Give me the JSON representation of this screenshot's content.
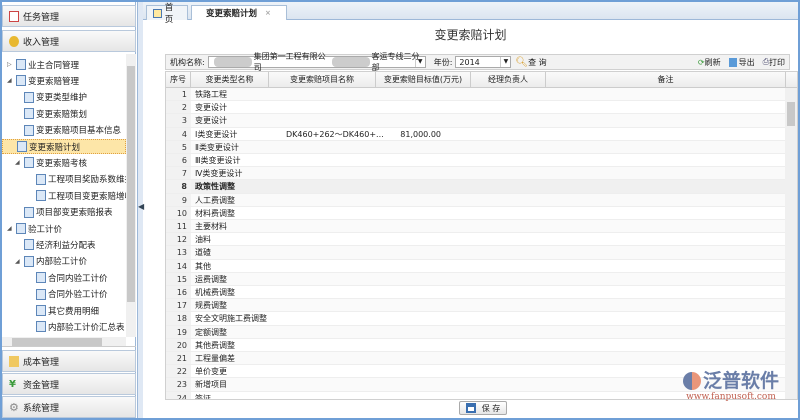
{
  "sidebar": {
    "sections_top": [
      "任务管理",
      "收入管理"
    ],
    "sections_bottom": [
      "成本管理",
      "资金管理",
      "系统管理"
    ],
    "tree": [
      {
        "label": "业主合同管理",
        "level": 0,
        "toggle": "▷"
      },
      {
        "label": "变更索赔管理",
        "level": 0,
        "toggle": "◢"
      },
      {
        "label": "变更类型维护",
        "level": 1
      },
      {
        "label": "变更索赔策划",
        "level": 1
      },
      {
        "label": "变更索赔项目基本信息",
        "level": 1
      },
      {
        "label": "变更索赔计划",
        "level": 1,
        "selected": true
      },
      {
        "label": "变更索赔考核",
        "level": 1,
        "toggle": "◢"
      },
      {
        "label": "工程项目奖励系数维护",
        "level": 2
      },
      {
        "label": "工程项目变更索赔增收统",
        "level": 2
      },
      {
        "label": "项目部变更索赔报表",
        "level": 1
      },
      {
        "label": "验工计价",
        "level": 0,
        "toggle": "◢"
      },
      {
        "label": "经济利益分配表",
        "level": 1
      },
      {
        "label": "内部验工计价",
        "level": 1,
        "toggle": "◢"
      },
      {
        "label": "合同内验工计价",
        "level": 2
      },
      {
        "label": "合同外验工计价",
        "level": 2
      },
      {
        "label": "其它费用明细",
        "level": 2
      },
      {
        "label": "内部验工计价汇总表",
        "level": 2
      }
    ]
  },
  "tabs": {
    "home": "首页",
    "active": "变更索赔计划"
  },
  "page_title": "变更索赔计划",
  "toolbar": {
    "org_label": "机构名称:",
    "org_part1": "集团第一工程有限公司",
    "org_part2": "客运专线二分部",
    "year_label": "年份:",
    "year": "2014",
    "query": "查 询",
    "refresh": "刷新",
    "export": "导出",
    "print": "打印"
  },
  "grid": {
    "headers": [
      "序号",
      "变更类型名称",
      "变更索赔项目名称",
      "变更索赔目标值(万元)",
      "经理负责人",
      "备注"
    ],
    "rows": [
      {
        "n": "1",
        "type": "铁路工程"
      },
      {
        "n": "2",
        "type": "变更设计"
      },
      {
        "n": "3",
        "type": "变更设计"
      },
      {
        "n": "4",
        "type": "Ⅰ类变更设计",
        "project": "DK460+262～DK460+...",
        "value": "81,000.00"
      },
      {
        "n": "5",
        "type": "Ⅱ类变更设计"
      },
      {
        "n": "6",
        "type": "Ⅲ类变更设计"
      },
      {
        "n": "7",
        "type": "Ⅳ类变更设计"
      },
      {
        "n": "8",
        "type": "政策性调整",
        "bold": true
      },
      {
        "n": "9",
        "type": "人工费调整"
      },
      {
        "n": "10",
        "type": "材料费调整"
      },
      {
        "n": "11",
        "type": "主要材料"
      },
      {
        "n": "12",
        "type": "油料"
      },
      {
        "n": "13",
        "type": "道碴"
      },
      {
        "n": "14",
        "type": "其他"
      },
      {
        "n": "15",
        "type": "运费调整"
      },
      {
        "n": "16",
        "type": "机械费调整"
      },
      {
        "n": "17",
        "type": "规费调整"
      },
      {
        "n": "18",
        "type": "安全文明施工费调整"
      },
      {
        "n": "19",
        "type": "定额调整"
      },
      {
        "n": "20",
        "type": "其他费调整"
      },
      {
        "n": "21",
        "type": "工程量偏差"
      },
      {
        "n": "22",
        "type": "单价变更"
      },
      {
        "n": "23",
        "type": "新增项目"
      },
      {
        "n": "24",
        "type": "签证"
      }
    ]
  },
  "save_label": "保 存",
  "watermark": {
    "name": "泛普软件",
    "url": "www.fanpusoft.com"
  }
}
